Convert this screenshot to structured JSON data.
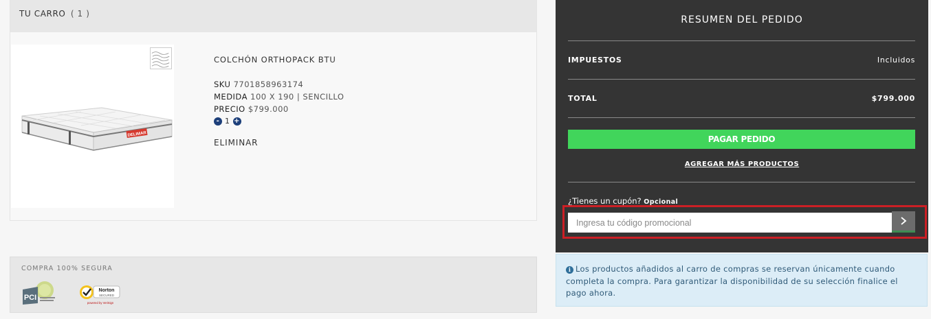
{
  "cart": {
    "header_label": "TU CARRO",
    "count_text": "( 1 )",
    "product": {
      "name": "COLCHÓN ORTHOPACK BTU",
      "sku_label": "SKU",
      "sku_value": "7701858963174",
      "size_label": "MEDIDA",
      "size_value": "100 X 190 | SENCILLO",
      "price_label": "PRECIO",
      "price_value": "$799.000",
      "quantity": "1",
      "minus_symbol": "-",
      "plus_symbol": "+",
      "remove_label": "ELIMINAR",
      "brand_label": "DELIMAR"
    }
  },
  "secure": {
    "title": "COMPRA 100% SEGURA",
    "pci_icon": "pci-logo",
    "norton_icon": "norton-secured-logo",
    "pci_text": "PCI",
    "norton_text": "Norton",
    "norton_sub": "SECURED",
    "norton_powered": "powered by VeriSign"
  },
  "summary": {
    "title": "RESUMEN DEL PEDIDO",
    "taxes_label": "IMPUESTOS",
    "taxes_value": "Incluidos",
    "total_label": "TOTAL",
    "total_value": "$799.000",
    "pay_button": "PAGAR PEDIDO",
    "more_products_link": "AGREGAR MÁS PRODUCTOS",
    "coupon_question": "¿Tienes un cupón?",
    "coupon_optional": "Opcional",
    "coupon_placeholder": "Ingresa tu código promocional",
    "coupon_submit_icon": "chevron-right-icon"
  },
  "notice": {
    "icon": "info-icon",
    "icon_glyph": "i",
    "text": "Los productos añadidos al carro de compras se reservan únicamente cuando completa la compra. Para garantizar la disponibilidad de su selección finalice el pago ahora."
  },
  "colors": {
    "summary_bg": "#343434",
    "pay_button": "#41d55b",
    "highlight_border": "#cc1f25",
    "notice_bg": "#dcedf7",
    "qty_button": "#1d3f7a"
  }
}
